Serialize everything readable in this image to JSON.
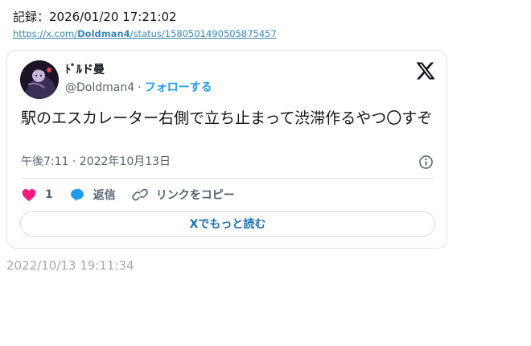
{
  "record": {
    "label": "記録：2026/01/20 17:21:02"
  },
  "source": {
    "prefix": "https://x.com/",
    "user": "Doldman4",
    "suffix": "/status/1580501490505875457"
  },
  "tweet": {
    "display_name": "ﾄﾞﾙド曼",
    "handle": "@Doldman4",
    "separator": "·",
    "follow_label": "フォローする",
    "text": "駅のエスカレーター右側で立ち止まって渋滞作るやつ〇すぞ",
    "timestamp": "午後7:11 · 2022年10月13日",
    "like_count": "1",
    "reply_label": "返信",
    "copy_link_label": "リンクをコピー",
    "read_more_label": "Xでもっと読む",
    "brand_icon": "x-logo-icon",
    "colors": {
      "like": "#f91880",
      "reply": "#1d9bf0",
      "link": "#1d9bf0"
    }
  },
  "footer": {
    "date": "2022/10/13 19:11:34"
  }
}
